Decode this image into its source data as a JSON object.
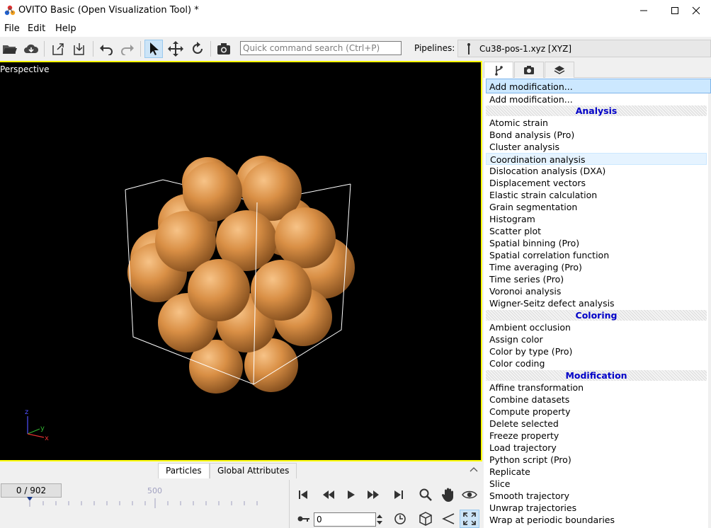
{
  "window": {
    "title": "OVITO Basic (Open Visualization Tool) *"
  },
  "menu": [
    "File",
    "Edit",
    "Help"
  ],
  "toolbar": {
    "search_placeholder": "Quick command search (Ctrl+P)",
    "pipelines_label": "Pipelines:",
    "pipeline_name": "Cu38-pos-1.xyz [XYZ]"
  },
  "viewport": {
    "caption": "Perspective",
    "axes": {
      "z": "z",
      "y": "y",
      "x": "x"
    },
    "colors": {
      "background": "#000000",
      "particle": "#c8823a",
      "border": "#ffff00",
      "cell": "#ffffff"
    }
  },
  "bottom_tabs": [
    "Particles",
    "Global Attributes"
  ],
  "timeline": {
    "frame_display": "0 / 902",
    "tick_label": "500"
  },
  "playback": {
    "frame_value": "0"
  },
  "modifier_panel": {
    "combo_value": "Add modification...",
    "first_item": "Add modification...",
    "selected": "Coordination analysis",
    "groups": [
      {
        "header": "Analysis",
        "items": [
          "Atomic strain",
          "Bond analysis (Pro)",
          "Cluster analysis",
          "Coordination analysis",
          "Dislocation analysis (DXA)",
          "Displacement vectors",
          "Elastic strain calculation",
          "Grain segmentation",
          "Histogram",
          "Scatter plot",
          "Spatial binning (Pro)",
          "Spatial correlation function",
          "Time averaging (Pro)",
          "Time series (Pro)",
          "Voronoi analysis",
          "Wigner-Seitz defect analysis"
        ]
      },
      {
        "header": "Coloring",
        "items": [
          "Ambient occlusion",
          "Assign color",
          "Color by type (Pro)",
          "Color coding"
        ]
      },
      {
        "header": "Modification",
        "items": [
          "Affine transformation",
          "Combine datasets",
          "Compute property",
          "Delete selected",
          "Freeze property",
          "Load trajectory",
          "Python script (Pro)",
          "Replicate",
          "Slice",
          "Smooth trajectory",
          "Unwrap trajectories",
          "Wrap at periodic boundaries"
        ]
      }
    ]
  }
}
